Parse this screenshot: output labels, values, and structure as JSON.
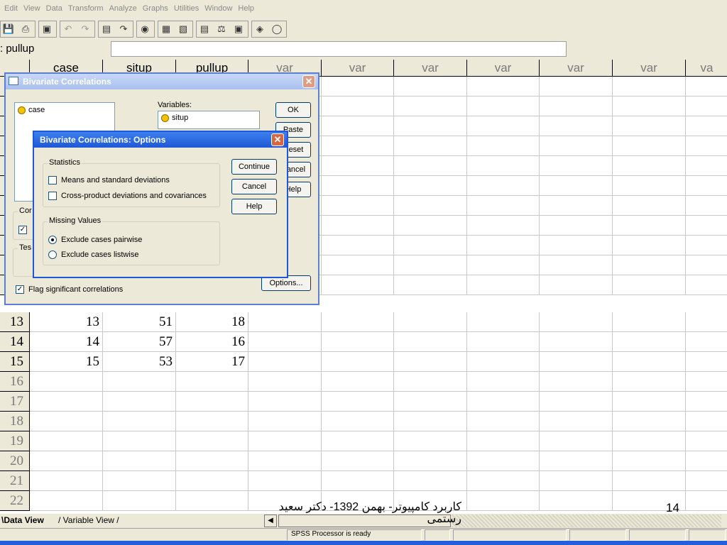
{
  "menu": [
    "Edit",
    "View",
    "Data",
    "Transform",
    "Analyze",
    "Graphs",
    "Utilities",
    "Window",
    "Help"
  ],
  "toolbar_icons": [
    "save-icon",
    "print-icon",
    "dialog-recall-icon",
    "undo-icon",
    "redo-icon",
    "goto-chart-icon",
    "goto-case-icon",
    "variables-icon",
    "find-icon",
    "insert-case-icon",
    "insert-variable-icon",
    "split-file-icon",
    "weight-cases-icon",
    "select-cases-icon",
    "value-labels-icon",
    "use-sets-icon"
  ],
  "cell_editor": {
    "name": ": pullup",
    "value": ""
  },
  "grid": {
    "columns": [
      "case",
      "situp",
      "pullup",
      "var",
      "var",
      "var",
      "var",
      "var",
      "var",
      "va"
    ],
    "rows": [
      {
        "num": "13",
        "case": "13",
        "situp": "51",
        "pullup": "18"
      },
      {
        "num": "14",
        "case": "14",
        "situp": "57",
        "pullup": "16"
      },
      {
        "num": "15",
        "case": "15",
        "situp": "53",
        "pullup": "17"
      }
    ],
    "empty_rows": [
      "16",
      "17",
      "18",
      "19",
      "20",
      "21",
      "22"
    ]
  },
  "dialog_main": {
    "title": "Bivariate Correlations",
    "source_vars": [
      "case"
    ],
    "variables_label": "Variables:",
    "selected_vars": [
      "situp"
    ],
    "buttons": {
      "ok": "OK",
      "paste": "Paste",
      "reset": "Reset",
      "cancel": "Cancel",
      "help": "Help",
      "options": "Options..."
    },
    "coef_group": "Cor",
    "test_group": "Tes",
    "flag_label": "Flag significant correlations",
    "flag_checked": true
  },
  "dialog_options": {
    "title": "Bivariate Correlations: Options",
    "statistics_title": "Statistics",
    "stat_means": "Means and standard deviations",
    "stat_cross": "Cross-product deviations and covariances",
    "missing_title": "Missing Values",
    "missing_pairwise": "Exclude cases pairwise",
    "missing_listwise": "Exclude cases listwise",
    "pairwise_selected": true,
    "buttons": {
      "continue": "Continue",
      "cancel": "Cancel",
      "help": "Help"
    }
  },
  "tabs": {
    "data_view": "Data View",
    "variable_view": "Variable View"
  },
  "status": "SPSS Processor  is ready",
  "overlay": {
    "caption": "کاربرد کامپیوتر- بهمن 1392- دکتر سعید رستمی",
    "page_number": "14"
  }
}
